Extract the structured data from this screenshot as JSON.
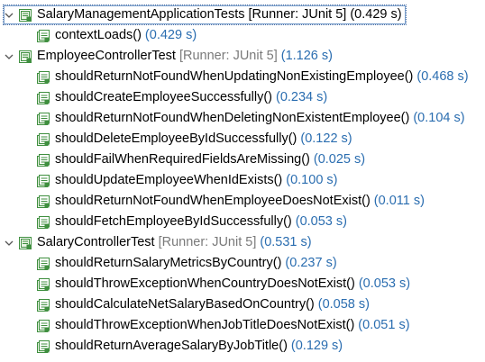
{
  "tree": [
    {
      "kind": "suite",
      "name": "SalaryManagementApplicationTests",
      "runner": "[Runner: JUnit 5]",
      "time": "(0.429 s)",
      "selected": true,
      "icon": "test-suite-passed-icon",
      "children": [
        {
          "name": "contextLoads()",
          "time": "(0.429 s)",
          "icon": "test-passed-icon"
        }
      ]
    },
    {
      "kind": "suite",
      "name": "EmployeeControllerTest",
      "runner": "[Runner: JUnit 5]",
      "time": "(1.126 s)",
      "selected": false,
      "icon": "test-suite-passed-icon",
      "children": [
        {
          "name": "shouldReturnNotFoundWhenUpdatingNonExistingEmployee()",
          "time": "(0.468 s)",
          "icon": "test-passed-icon"
        },
        {
          "name": "shouldCreateEmployeeSuccessfully()",
          "time": "(0.234 s)",
          "icon": "test-passed-icon"
        },
        {
          "name": "shouldReturnNotFoundWhenDeletingNonExistentEmployee()",
          "time": "(0.104 s)",
          "icon": "test-passed-icon"
        },
        {
          "name": "shouldDeleteEmployeeByIdSuccessfully()",
          "time": "(0.122 s)",
          "icon": "test-passed-icon"
        },
        {
          "name": "shouldFailWhenRequiredFieldsAreMissing()",
          "time": "(0.025 s)",
          "icon": "test-passed-icon"
        },
        {
          "name": "shouldUpdateEmployeeWhenIdExists()",
          "time": "(0.100 s)",
          "icon": "test-passed-icon"
        },
        {
          "name": "shouldReturnNotFoundWhenEmployeeDoesNotExist()",
          "time": "(0.011 s)",
          "icon": "test-passed-icon"
        },
        {
          "name": "shouldFetchEmployeeByIdSuccessfully()",
          "time": "(0.053 s)",
          "icon": "test-passed-icon"
        }
      ]
    },
    {
      "kind": "suite",
      "name": "SalaryControllerTest",
      "runner": "[Runner: JUnit 5]",
      "time": "(0.531 s)",
      "selected": false,
      "icon": "test-suite-passed-icon",
      "children": [
        {
          "name": "shouldReturnSalaryMetricsByCountry()",
          "time": "(0.237 s)",
          "icon": "test-passed-icon"
        },
        {
          "name": "shouldThrowExceptionWhenCountryDoesNotExist()",
          "time": "(0.053 s)",
          "icon": "test-passed-icon"
        },
        {
          "name": "shouldCalculateNetSalaryBasedOnCountry()",
          "time": "(0.058 s)",
          "icon": "test-passed-icon"
        },
        {
          "name": "shouldThrowExceptionWhenJobTitleDoesNotExist()",
          "time": "(0.051 s)",
          "icon": "test-passed-icon"
        },
        {
          "name": "shouldReturnAverageSalaryByJobTitle()",
          "time": "(0.129 s)",
          "icon": "test-passed-icon"
        }
      ]
    }
  ],
  "colors": {
    "time": "#2a6db0",
    "runner": "#7a7a7a",
    "icon_green": "#3f8f3f",
    "selection_border": "#7da2ce"
  }
}
